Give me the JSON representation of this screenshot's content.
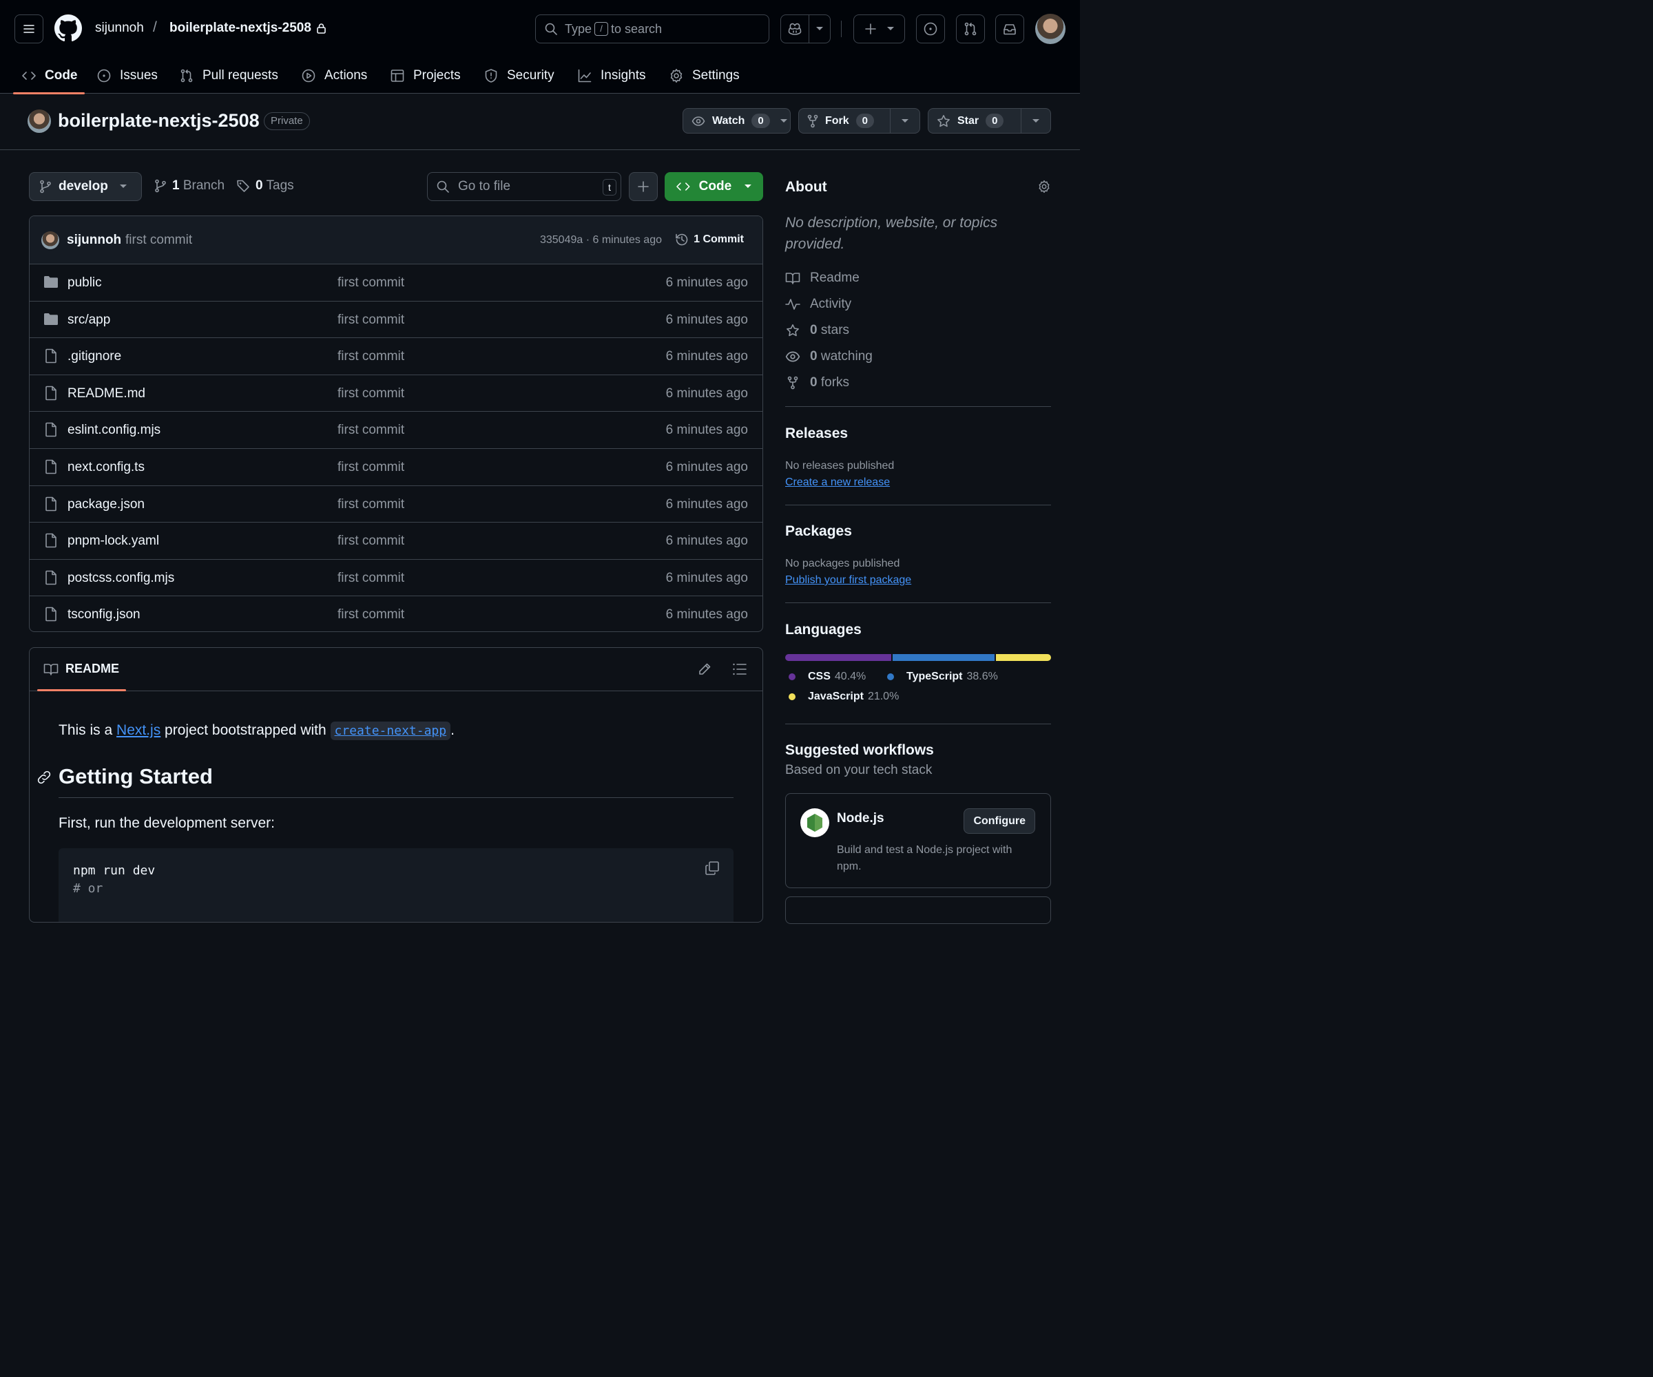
{
  "header": {
    "owner": "sijunnoh",
    "separator": "/",
    "repo": "boilerplate-nextjs-2508",
    "search": {
      "prefix": "Type",
      "key": "/",
      "suffix": "to search"
    }
  },
  "tabs": [
    {
      "label": "Code",
      "icon": "code-icon",
      "active": true
    },
    {
      "label": "Issues",
      "icon": "issue-icon"
    },
    {
      "label": "Pull requests",
      "icon": "pull-request-icon"
    },
    {
      "label": "Actions",
      "icon": "play-icon"
    },
    {
      "label": "Projects",
      "icon": "table-icon"
    },
    {
      "label": "Security",
      "icon": "shield-icon"
    },
    {
      "label": "Insights",
      "icon": "graph-icon"
    },
    {
      "label": "Settings",
      "icon": "gear-icon"
    }
  ],
  "repo_header": {
    "title": "boilerplate-nextjs-2508",
    "visibility": "Private",
    "watch": {
      "label": "Watch",
      "count": "0"
    },
    "fork": {
      "label": "Fork",
      "count": "0"
    },
    "star": {
      "label": "Star",
      "count": "0"
    }
  },
  "file_nav": {
    "branch": "develop",
    "branches_count": "1",
    "branches_label": "Branch",
    "tags_count": "0",
    "tags_label": "Tags",
    "goto_placeholder": "Go to file",
    "goto_key": "t",
    "code_button": "Code"
  },
  "latest_commit": {
    "author": "sijunnoh",
    "message": "first commit",
    "sha_time": "335049a · 6 minutes ago",
    "commits_label": "1 Commit"
  },
  "files": [
    {
      "name": "public",
      "type": "folder",
      "message": "first commit",
      "age": "6 minutes ago"
    },
    {
      "name": "src/app",
      "type": "folder",
      "message": "first commit",
      "age": "6 minutes ago"
    },
    {
      "name": ".gitignore",
      "type": "file",
      "message": "first commit",
      "age": "6 minutes ago"
    },
    {
      "name": "README.md",
      "type": "file",
      "message": "first commit",
      "age": "6 minutes ago"
    },
    {
      "name": "eslint.config.mjs",
      "type": "file",
      "message": "first commit",
      "age": "6 minutes ago"
    },
    {
      "name": "next.config.ts",
      "type": "file",
      "message": "first commit",
      "age": "6 minutes ago"
    },
    {
      "name": "package.json",
      "type": "file",
      "message": "first commit",
      "age": "6 minutes ago"
    },
    {
      "name": "pnpm-lock.yaml",
      "type": "file",
      "message": "first commit",
      "age": "6 minutes ago"
    },
    {
      "name": "postcss.config.mjs",
      "type": "file",
      "message": "first commit",
      "age": "6 minutes ago"
    },
    {
      "name": "tsconfig.json",
      "type": "file",
      "message": "first commit",
      "age": "6 minutes ago"
    }
  ],
  "readme": {
    "tab": "README",
    "intro_before": "This is a ",
    "intro_link": "Next.js",
    "intro_middle": " project bootstrapped with ",
    "intro_code": "create-next-app",
    "intro_after": ".",
    "heading": "Getting Started",
    "paragraph": "First, run the development server:",
    "code_line1": "npm run dev",
    "code_line2": "# or"
  },
  "sidebar": {
    "about_title": "About",
    "description": "No description, website, or topics provided.",
    "items": [
      {
        "icon": "book-icon",
        "count": "",
        "label": "Readme"
      },
      {
        "icon": "pulse-icon",
        "count": "",
        "label": "Activity"
      },
      {
        "icon": "star-icon",
        "count": "0",
        "label": "stars"
      },
      {
        "icon": "eye-icon",
        "count": "0",
        "label": "watching"
      },
      {
        "icon": "fork-icon",
        "count": "0",
        "label": "forks"
      }
    ],
    "releases_title": "Releases",
    "releases_none": "No releases published",
    "releases_link": "Create a new release",
    "packages_title": "Packages",
    "packages_none": "No packages published",
    "packages_link": "Publish your first package",
    "languages_title": "Languages",
    "languages": [
      {
        "name": "CSS",
        "percent": "40.4%",
        "value": 40.4,
        "color": "#663399"
      },
      {
        "name": "TypeScript",
        "percent": "38.6%",
        "value": 38.6,
        "color": "#3178c6"
      },
      {
        "name": "JavaScript",
        "percent": "21.0%",
        "value": 21.0,
        "color": "#f1e05a"
      }
    ],
    "workflows_title": "Suggested workflows",
    "workflows_subtitle": "Based on your tech stack",
    "workflow": {
      "name": "Node.js",
      "button": "Configure",
      "description": "Build and test a Node.js project with npm."
    }
  },
  "colors": {
    "background": "#0d1117",
    "header": "#010409",
    "border": "#3d444d",
    "accent_green": "#238636",
    "link": "#4493f8",
    "tab_underline": "#f78166"
  }
}
